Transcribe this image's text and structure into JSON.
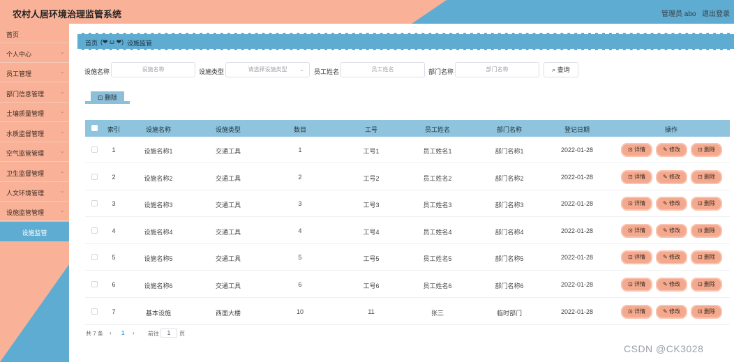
{
  "header": {
    "title": "农村人居环境治理监管系统",
    "admin_text": "管理员 abo",
    "logout": "退出登录"
  },
  "sidebar": {
    "items": [
      {
        "label": "首页",
        "chevron": ""
      },
      {
        "label": "个人中心",
        "chevron": "⌄"
      },
      {
        "label": "员工管理",
        "chevron": "⌄"
      },
      {
        "label": "部门信息管理",
        "chevron": "⌄"
      },
      {
        "label": "土壤质量管理",
        "chevron": "⌄"
      },
      {
        "label": "水质监督管理",
        "chevron": "⌄"
      },
      {
        "label": "空气监管管理",
        "chevron": "⌄"
      },
      {
        "label": "卫生监督管理",
        "chevron": "⌄"
      },
      {
        "label": "人文环境管理",
        "chevron": "⌄"
      },
      {
        "label": "设施监管管理",
        "chevron": "⌄"
      }
    ],
    "sub_item": "设施监管"
  },
  "breadcrumb": {
    "home": "首页",
    "emoji": "(❤ ω ❤)",
    "current": "设施监管"
  },
  "search": {
    "facility_name_label": "设施名称",
    "facility_name_placeholder": "设施名称",
    "facility_type_label": "设施类型",
    "facility_type_placeholder": "请选择设施类型",
    "staff_name_label": "员工姓名",
    "staff_name_placeholder": "员工姓名",
    "dept_label": "部门名称",
    "dept_placeholder": "部门名称",
    "query_button": "查询"
  },
  "toolbar": {
    "delete_label": "删除"
  },
  "table": {
    "headers": {
      "index": "索引",
      "name": "设施名称",
      "type": "设施类型",
      "count": "数目",
      "staff_no": "工号",
      "staff_name": "员工姓名",
      "dept": "部门名称",
      "date": "登记日期",
      "ops": "操作"
    },
    "rows": [
      {
        "index": "1",
        "name": "设施名称1",
        "type": "交通工具",
        "count": "1",
        "staff_no": "工号1",
        "staff_name": "员工姓名1",
        "dept": "部门名称1",
        "date": "2022-01-28"
      },
      {
        "index": "2",
        "name": "设施名称2",
        "type": "交通工具",
        "count": "2",
        "staff_no": "工号2",
        "staff_name": "员工姓名2",
        "dept": "部门名称2",
        "date": "2022-01-28"
      },
      {
        "index": "3",
        "name": "设施名称3",
        "type": "交通工具",
        "count": "3",
        "staff_no": "工号3",
        "staff_name": "员工姓名3",
        "dept": "部门名称3",
        "date": "2022-01-28"
      },
      {
        "index": "4",
        "name": "设施名称4",
        "type": "交通工具",
        "count": "4",
        "staff_no": "工号4",
        "staff_name": "员工姓名4",
        "dept": "部门名称4",
        "date": "2022-01-28"
      },
      {
        "index": "5",
        "name": "设施名称5",
        "type": "交通工具",
        "count": "5",
        "staff_no": "工号5",
        "staff_name": "员工姓名5",
        "dept": "部门名称5",
        "date": "2022-01-28"
      },
      {
        "index": "6",
        "name": "设施名称6",
        "type": "交通工具",
        "count": "6",
        "staff_no": "工号6",
        "staff_name": "员工姓名6",
        "dept": "部门名称6",
        "date": "2022-01-28"
      },
      {
        "index": "7",
        "name": "基本设施",
        "type": "西面大楼",
        "count": "10",
        "staff_no": "11",
        "staff_name": "张三",
        "dept": "临时部门",
        "date": "2022-01-28"
      }
    ],
    "op_labels": {
      "detail": "⊡ 详情",
      "edit": "✎ 修改",
      "delete": "⊡ 删除"
    }
  },
  "pagination": {
    "total": "共 7 条",
    "prev": "‹",
    "current": "1",
    "next": "›",
    "goto": "前往",
    "page_value": "1",
    "page_suffix": "页"
  },
  "watermark": "CSDN @CK3028",
  "colors": {
    "peach": "#f9b298",
    "blue": "#5eacd2",
    "table_header": "#8ec4de",
    "op_button": "#f4a98e"
  }
}
